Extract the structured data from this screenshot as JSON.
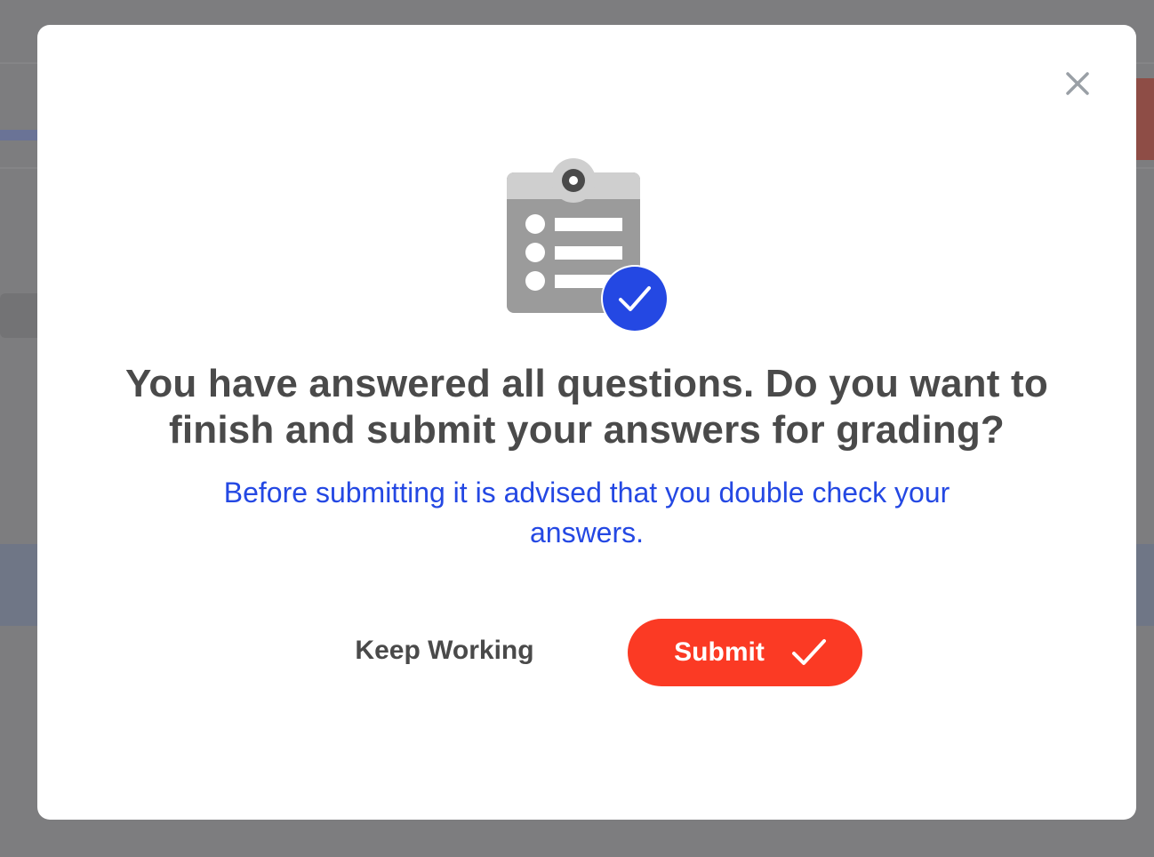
{
  "dialog": {
    "title": "You have answered all questions. Do you want to finish and submit your answers for grading?",
    "subtitle": "Before submitting it is advised that you double check your answers.",
    "keep_working_label": "Keep Working",
    "submit_label": "Submit",
    "close_icon": "close-icon",
    "illustration_icon": "clipboard-check-icon",
    "submit_icon": "checkmark-icon"
  },
  "colors": {
    "overlay": "#7d7d7f",
    "modal_bg": "#ffffff",
    "title_text": "#4a4a4a",
    "subtitle_text": "#2448e3",
    "submit_bg": "#fb3a24",
    "check_badge": "#2448e3",
    "clipboard_gray": "#9b9b9b"
  }
}
